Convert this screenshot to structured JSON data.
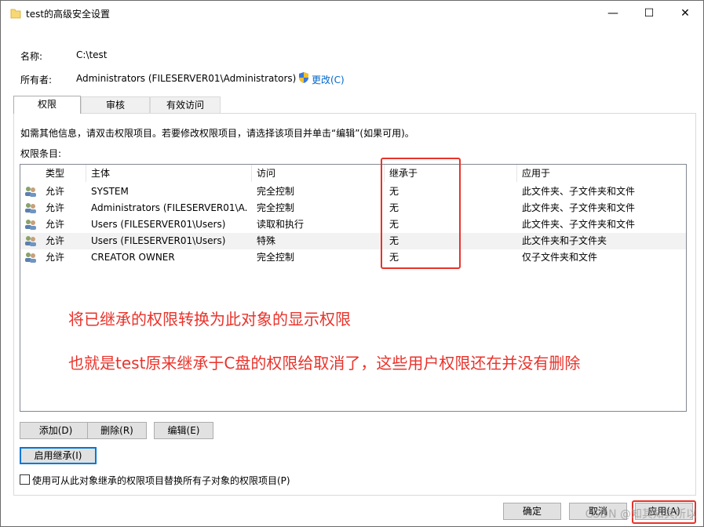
{
  "window": {
    "title": "test的高级安全设置",
    "controls": {
      "minimize": "—",
      "maximize": "☐",
      "close": "✕"
    }
  },
  "name_row": {
    "label": "名称:",
    "value": "C:\\test"
  },
  "owner_row": {
    "label": "所有者:",
    "value": "Administrators (FILESERVER01\\Administrators)",
    "change_link": "更改(C)"
  },
  "tabs": [
    {
      "label": "权限",
      "active": true
    },
    {
      "label": "审核",
      "active": false
    },
    {
      "label": "有效访问",
      "active": false
    }
  ],
  "info_text": "如需其他信息，请双击权限项目。若要修改权限项目，请选择该项目并单击“编辑”(如果可用)。",
  "entries_label": "权限条目:",
  "columns": [
    "类型",
    "主体",
    "访问",
    "继承于",
    "应用于"
  ],
  "rows": [
    {
      "type": "允许",
      "principal": "SYSTEM",
      "access": "完全控制",
      "inherited": "无",
      "applies": "此文件夹、子文件夹和文件"
    },
    {
      "type": "允许",
      "principal": "Administrators (FILESERVER01\\A...",
      "access": "完全控制",
      "inherited": "无",
      "applies": "此文件夹、子文件夹和文件"
    },
    {
      "type": "允许",
      "principal": "Users (FILESERVER01\\Users)",
      "access": "读取和执行",
      "inherited": "无",
      "applies": "此文件夹、子文件夹和文件"
    },
    {
      "type": "允许",
      "principal": "Users (FILESERVER01\\Users)",
      "access": "特殊",
      "inherited": "无",
      "applies": "此文件夹和子文件夹"
    },
    {
      "type": "允许",
      "principal": "CREATOR OWNER",
      "access": "完全控制",
      "inherited": "无",
      "applies": "仅子文件夹和文件"
    }
  ],
  "annotations": {
    "line1": "将已继承的权限转换为此对象的显示权限",
    "line2": "也就是test原来继承于C盘的权限给取消了，这些用户权限还在并没有删除"
  },
  "buttons": {
    "add": "添加(D)",
    "remove": "删除(R)",
    "edit": "编辑(E)",
    "enable_inheritance": "启用继承(I)",
    "ok": "确定",
    "cancel": "取消",
    "apply": "应用(A)"
  },
  "replace_checkbox": {
    "label": "使用可从此对象继承的权限项目替换所有子对象的权限项目(P)",
    "checked": false
  },
  "watermark": "CSDN @知其知其所以",
  "colors": {
    "annotation_red": "#e8332b",
    "link_blue": "#0066cc",
    "selection": "#e5f3ff"
  }
}
